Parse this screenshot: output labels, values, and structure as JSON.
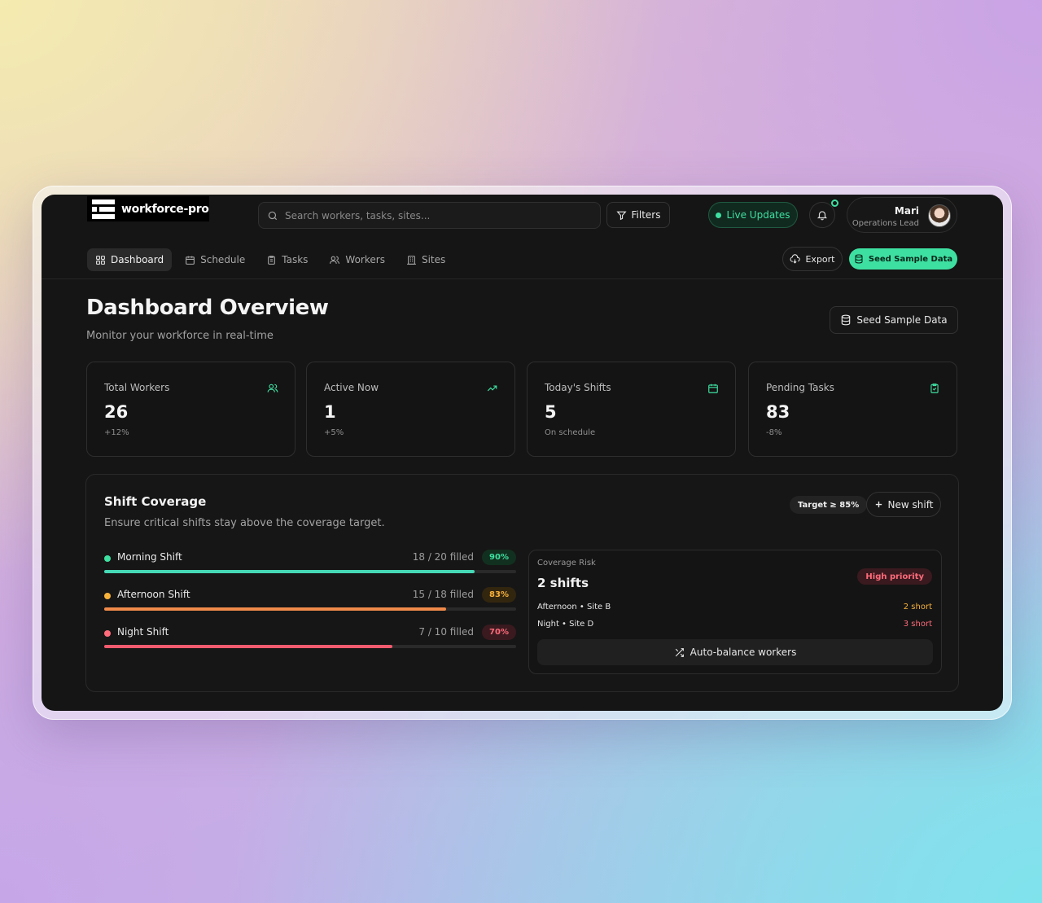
{
  "app": {
    "logo_text": "workforce-pro"
  },
  "header": {
    "search_placeholder": "Search workers, tasks, sites...",
    "filters_label": "Filters",
    "live_label": "Live Updates",
    "user": {
      "name": "Mari",
      "role": "Operations Lead"
    }
  },
  "nav": {
    "items": [
      {
        "label": "Dashboard",
        "icon": "grid-icon",
        "active": true
      },
      {
        "label": "Schedule",
        "icon": "calendar-icon"
      },
      {
        "label": "Tasks",
        "icon": "clipboard-icon"
      },
      {
        "label": "Workers",
        "icon": "users-icon"
      },
      {
        "label": "Sites",
        "icon": "building-icon"
      }
    ],
    "export_label": "Export",
    "seed_label": "Seed Sample Data"
  },
  "page": {
    "title": "Dashboard Overview",
    "subtitle": "Monitor your workforce in real-time",
    "seed_label": "Seed Sample Data"
  },
  "stats": [
    {
      "label": "Total Workers",
      "value": "26",
      "sub": "+12%",
      "icon": "users-icon"
    },
    {
      "label": "Active Now",
      "value": "1",
      "sub": "+5%",
      "icon": "trending-up-icon"
    },
    {
      "label": "Today's Shifts",
      "value": "5",
      "sub": "On schedule",
      "icon": "calendar-icon"
    },
    {
      "label": "Pending Tasks",
      "value": "83",
      "sub": "-8%",
      "icon": "clipboard-check-icon"
    }
  ],
  "coverage": {
    "title": "Shift Coverage",
    "subtitle": "Ensure critical shifts stay above the coverage target.",
    "target_label": "Target ≥ 85%",
    "new_shift_label": "New shift",
    "shifts": [
      {
        "name": "Morning Shift",
        "filled": "18 / 20 filled",
        "pct": "90%",
        "value": 0.9,
        "color": "#3ee0a1",
        "bar": "#46d9b6"
      },
      {
        "name": "Afternoon Shift",
        "filled": "15 / 18 filled",
        "pct": "83%",
        "value": 0.83,
        "color": "#f7b23b",
        "bar": "#f08a4a"
      },
      {
        "name": "Night Shift",
        "filled": "7 / 10 filled",
        "pct": "70%",
        "value": 0.7,
        "color": "#ff6b7a",
        "bar": "#f25a6e"
      }
    ],
    "risk": {
      "label": "Coverage Risk",
      "value": "2 shifts",
      "priority": "High priority",
      "rows": [
        {
          "name": "Afternoon • Site B",
          "short": "2 short",
          "color": "#f7b23b"
        },
        {
          "name": "Night • Site D",
          "short": "3 short",
          "color": "#ff6b7a"
        }
      ],
      "action_label": "Auto-balance workers"
    }
  },
  "colors": {
    "accent": "#3ee0a1",
    "background": "#151515",
    "danger": "#ff6b7a",
    "warning": "#f7b23b"
  }
}
